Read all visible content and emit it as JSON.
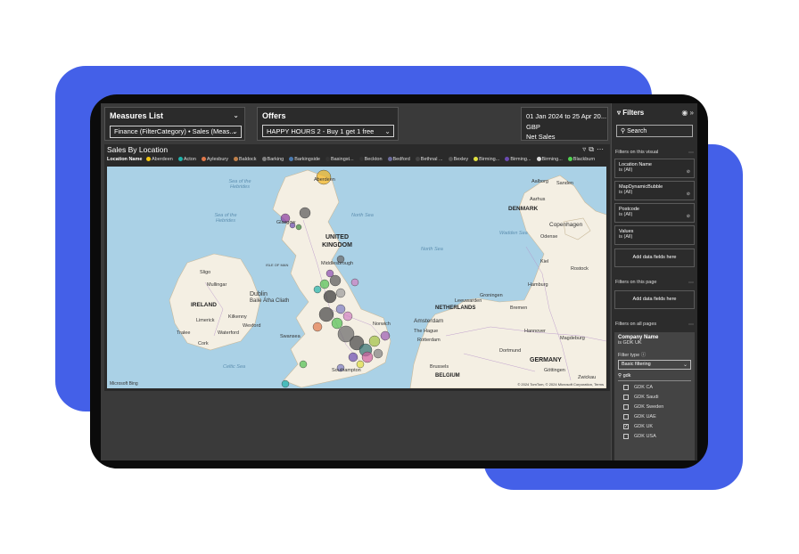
{
  "measures": {
    "title": "Measures List",
    "selected": "Finance (FilterCategory) • Sales (Meas..."
  },
  "offers": {
    "title": "Offers",
    "selected": "HAPPY HOURS 2 - Buy 1 get 1 free"
  },
  "info": {
    "date_range": "01 Jan 2024 to 25 Apr 20...",
    "currency": "GBP",
    "measure": "Net Sales"
  },
  "visual": {
    "title": "Sales By Location",
    "legend_label": "Location Name",
    "legend": [
      {
        "name": "Aberdeen",
        "color": "#f2c511"
      },
      {
        "name": "Acton",
        "color": "#20b2aa"
      },
      {
        "name": "Aylesbury",
        "color": "#e0784a"
      },
      {
        "name": "Baldock",
        "color": "#c0804a"
      },
      {
        "name": "Barking",
        "color": "#7f7f7f"
      },
      {
        "name": "Barkingside",
        "color": "#4a7ab0"
      },
      {
        "name": "Basingst...",
        "color": "#333333"
      },
      {
        "name": "Beckton",
        "color": "#333333"
      },
      {
        "name": "Bedford",
        "color": "#6b6b9b"
      },
      {
        "name": "Bethnal ...",
        "color": "#444444"
      },
      {
        "name": "Bexley",
        "color": "#555555"
      },
      {
        "name": "Birming...",
        "color": "#e0e040"
      },
      {
        "name": "Birming...",
        "color": "#6a4ab0"
      },
      {
        "name": "Birming...",
        "color": "#dddddd"
      },
      {
        "name": "Blackburn",
        "color": "#50d050"
      }
    ],
    "map_labels": {
      "sea_hebrides_1": "Sea of the Hebrides",
      "sea_hebrides_2": "Sea of the Hebrides",
      "north_sea": "North Sea",
      "north_sea_2": "North Sea",
      "uk": "UNITED KINGDOM",
      "isle_of_man": "ISLE OF MAN",
      "ireland": "IRELAND",
      "denmark": "DENMARK",
      "netherlands": "NETHERLANDS",
      "belgium": "BELGIUM",
      "germany": "GERMANY",
      "celtic_sea": "Celtic Sea",
      "aberdeen": "Aberdeen",
      "glasgow": "Glasgow",
      "middlesbrough": "Middlesbrough",
      "dublin": "Dublin",
      "baile_atha_cliath": "Baile Átha Cliath",
      "norwich": "Norwich",
      "amsterdam": "Amsterdam",
      "the_hague": "The Hague",
      "rotterdam": "Rotterdam",
      "brussels": "Brussels",
      "copenhagen": "Copenhagen",
      "hamburg": "Hamburg",
      "bremen": "Bremen",
      "hannover": "Hannover",
      "magdeburg": "Magdeburg",
      "dortmund": "Dortmund",
      "rostock": "Rostock",
      "odense": "Odense",
      "aalborg": "Aalborg",
      "aarhus": "Aarhus",
      "sligo": "Sligo",
      "mullingar": "Mullingar",
      "limerick": "Limerick",
      "kilkenny": "Kilkenny",
      "wexford": "Wexford",
      "waterford": "Waterford",
      "tralee": "Tralee",
      "cork": "Cork",
      "swansea": "Swansea",
      "southampton": "Southampton",
      "groningen": "Groningen",
      "leeuwarden": "Leeuwarden",
      "goettingen": "Göttingen",
      "zwickau": "Zwickau",
      "kiel": "Kiel",
      "sanden": "Sanden",
      "wadden": "Wadden Sea"
    },
    "watermark": "Microsoft Bing",
    "copyright": "© 2024 TomTom, © 2024 Microsoft Corporation, Terms"
  },
  "filters": {
    "title": "Filters",
    "search_placeholder": "Search",
    "on_visual": "Filters on this visual",
    "visual_filters": [
      {
        "name": "Location Name",
        "value": "is (All)"
      },
      {
        "name": "MapDynamicBubble",
        "value": "is (All)"
      },
      {
        "name": "Postcode",
        "value": "is (All)"
      },
      {
        "name": "Values",
        "value": "is (All)"
      }
    ],
    "add_fields": "Add data fields here",
    "on_page": "Filters on this page",
    "on_all_pages": "Filters on all pages",
    "company": {
      "name": "Company Name",
      "value": "is GDK UK",
      "filter_type_label": "Filter type",
      "filter_type": "Basic filtering",
      "search_value": "gdk",
      "options": [
        {
          "label": "GDK CA",
          "checked": false
        },
        {
          "label": "GDK Saudi",
          "checked": false
        },
        {
          "label": "GDK Sweden",
          "checked": false
        },
        {
          "label": "GDK UAE",
          "checked": false
        },
        {
          "label": "GDK UK",
          "checked": true
        },
        {
          "label": "GDK USA",
          "checked": false
        }
      ]
    }
  },
  "colors": {
    "blob": "#4460e8",
    "canvas": "#3a3a3a",
    "map_water": "#aad1e6",
    "map_land": "#f4efe3"
  }
}
